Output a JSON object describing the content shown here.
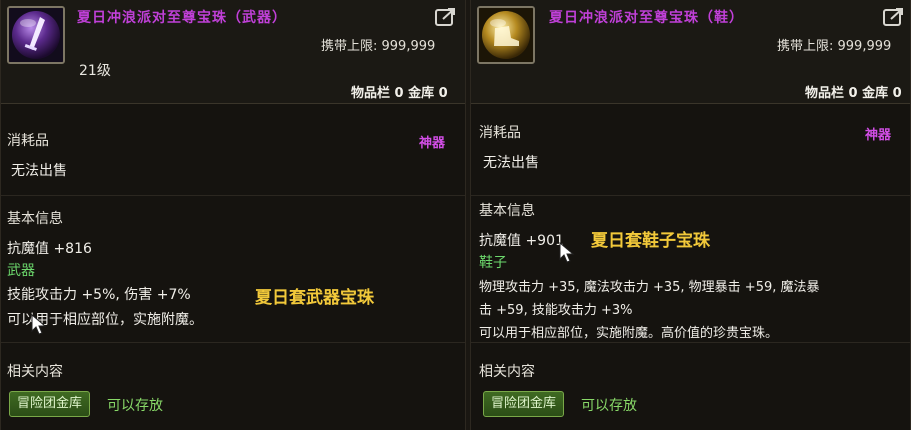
{
  "left_card": {
    "title": "夏日冲浪派对至尊宝珠（武器）",
    "carry_limit": "携带上限: 999,999",
    "level": "21级",
    "storage": "物品栏 0 金库 0",
    "category": "消耗品",
    "tag": "神器",
    "sell_status": "无法出售",
    "basic_info_label": "基本信息",
    "stat_line": "抗魔值 +816",
    "slot": "武器",
    "effect_line_1": "技能攻击力 +5%, 伤害 +7%",
    "effect_line_2": "可以用于相应部位，实施附魔。",
    "caption": "夏日套武器宝珠",
    "related_label": "相关内容",
    "storage_button": "冒险团金库",
    "can_store": "可以存放"
  },
  "right_card": {
    "title": "夏日冲浪派对至尊宝珠（鞋）",
    "carry_limit": "携带上限: 999,999",
    "storage": "物品栏 0 金库 0",
    "category": "消耗品",
    "tag": "神器",
    "sell_status": "无法出售",
    "basic_info_label": "基本信息",
    "stat_line": "抗魔值 +901",
    "caption": "夏日套鞋子宝珠",
    "slot": "鞋子",
    "effect_line_1": "物理攻击力 +35, 魔法攻击力 +35, 物理暴击 +59, 魔法暴",
    "effect_line_2": "击 +59, 技能攻击力 +3%",
    "effect_line_3": "可以用于相应部位，实施附魔。高价值的珍贵宝珠。",
    "related_label": "相关内容",
    "storage_button": "冒险团金库",
    "can_store": "可以存放"
  },
  "colors": {
    "title": "#c040d8",
    "artifact_tag": "#d24ee6",
    "slot_green": "#6cd86c",
    "caption_yellow": "#f2c93a",
    "button_green": "#3f6a22"
  },
  "icons": {
    "left_item": "purple-orb-sword-icon",
    "right_item": "gold-orb-shoe-icon",
    "share": "share-icon",
    "cursor": "mouse-cursor-icon"
  }
}
